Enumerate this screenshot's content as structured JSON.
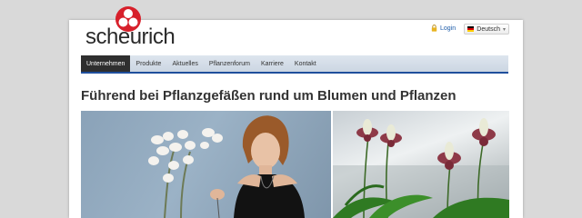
{
  "brand": {
    "name": "scheurich",
    "color": "#d7202b"
  },
  "header": {
    "login_label": "Login",
    "language_label": "Deutsch",
    "lock_icon": "lock-icon",
    "flag_icon": "german-flag-icon"
  },
  "nav": {
    "items": [
      "Unternehmen",
      "Produkte",
      "Aktuelles",
      "Pflanzenforum",
      "Karriere",
      "Kontakt"
    ],
    "active_index": 0,
    "accent": "#1f4f9c"
  },
  "main": {
    "headline": "Führend bei Pflanzgefäßen rund um Blumen und Pflanzen"
  }
}
